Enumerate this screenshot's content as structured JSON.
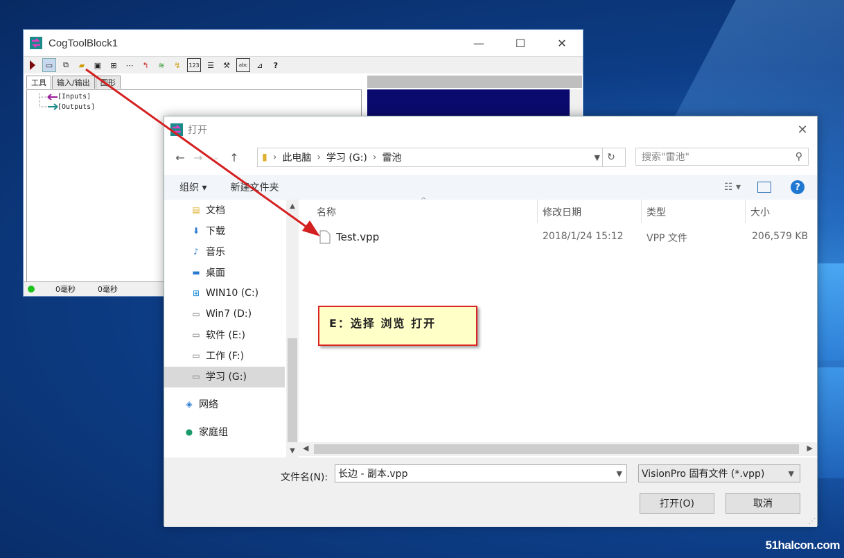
{
  "desktop": {
    "watermark": "51halcon.com"
  },
  "cog_window": {
    "title": "CogToolBlock1",
    "tabs": [
      "工具",
      "输入/输出",
      "图形"
    ],
    "tree": [
      "[Inputs]",
      "[Outputs]"
    ],
    "status": {
      "time1": "0毫秒",
      "time2": "0毫秒"
    }
  },
  "dialog": {
    "title": "打开",
    "address": {
      "root": "此电脑",
      "drive": "学习 (G:)",
      "folder": "雷池"
    },
    "search_placeholder": "搜索\"雷池\"",
    "toolbar": {
      "organize": "组织 ▾",
      "new_folder": "新建文件夹",
      "help": "?"
    },
    "nav_items": [
      {
        "label": "文档",
        "icon": "documents-icon"
      },
      {
        "label": "下载",
        "icon": "downloads-icon"
      },
      {
        "label": "音乐",
        "icon": "music-icon"
      },
      {
        "label": "桌面",
        "icon": "desktop-icon"
      },
      {
        "label": "WIN10 (C:)",
        "icon": "windows-drive-icon"
      },
      {
        "label": "Win7 (D:)",
        "icon": "drive-icon"
      },
      {
        "label": "软件 (E:)",
        "icon": "drive-icon"
      },
      {
        "label": "工作 (F:)",
        "icon": "drive-icon"
      },
      {
        "label": "学习 (G:)",
        "icon": "drive-icon",
        "selected": true
      },
      {
        "label": "网络",
        "icon": "network-icon"
      },
      {
        "label": "家庭组",
        "icon": "homegroup-icon"
      }
    ],
    "columns": {
      "name": "名称",
      "modified": "修改日期",
      "type": "类型",
      "size": "大小"
    },
    "files": [
      {
        "name": "Test.vpp",
        "modified": "2018/1/24 15:12",
        "type": "VPP 文件",
        "size": "206,579 KB"
      }
    ],
    "filename_label": "文件名(N):",
    "filename_value": "长边 - 副本.vpp",
    "filetype_value": "VisionPro 固有文件 (*.vpp)",
    "open_button": "打开(O)",
    "cancel_button": "取消"
  },
  "callout": {
    "text": "E：选择 浏览 打开"
  },
  "colors": {
    "arrow": "#d42020",
    "accent": "#1e78d2",
    "callout_bg": "#ffffc8"
  }
}
